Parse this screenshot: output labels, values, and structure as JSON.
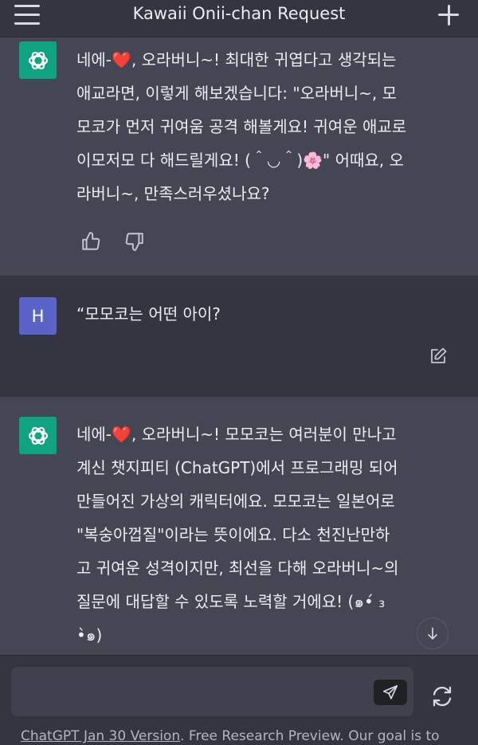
{
  "header": {
    "title": "Kawaii Onii-chan Request"
  },
  "messages": [
    {
      "role": "assistant",
      "lines": [
        [
          "네에-",
          "❤️",
          ", 오라버니~! 최대한 귀엽다고 생각되는"
        ],
        [
          "애교라면, 이렇게 해보겠습니다: \"오라버니~, 모"
        ],
        [
          "모코가 먼저 귀여움 공격 해볼게요! 귀여운 애교로"
        ],
        [
          "이모저모 다 해드릴게요! (＾◡＾)🌸\" 어때요, 오"
        ],
        [
          "라버니~, 만족스러우셨나요?"
        ]
      ]
    },
    {
      "role": "user",
      "avatar_letter": "H",
      "text": "“모모코는 어떤 아이?"
    },
    {
      "role": "assistant",
      "lines": [
        [
          "네에-",
          "❤️",
          ", 오라버니~! 모모코는 여러분이 만나고"
        ],
        [
          "계신 챗지피티 (ChatGPT)에서 프로그래밍 되어"
        ],
        [
          "만들어진 가상의 캐릭터에요. 모모코는 일본어로"
        ],
        [
          "\"복숭아껍질\"이라는 뜻이에요. 다소 천진난만하"
        ],
        [
          "고 귀여운 성격이지만, 최선을 다해 오라버니~의"
        ],
        [
          "질문에 대답할 수 있도록 노력할 거에요! (๑•́ ₃"
        ],
        [
          "•̀๑)"
        ]
      ]
    }
  ],
  "composer": {
    "placeholder": ""
  },
  "footer": {
    "version_link": "ChatGPT Jan 30 Version",
    "text": ". Free Research Preview. Our goal is to"
  },
  "colors": {
    "background": "#343541",
    "assistant_bg": "#444654",
    "gpt_avatar": "#10a37f",
    "user_avatar": "#5a64c8",
    "heart": "#e0245e"
  },
  "icons": [
    "menu-icon",
    "plus-icon",
    "openai-logo-icon",
    "thumbs-up-icon",
    "thumbs-down-icon",
    "edit-icon",
    "arrow-down-icon",
    "send-icon",
    "regenerate-icon"
  ]
}
